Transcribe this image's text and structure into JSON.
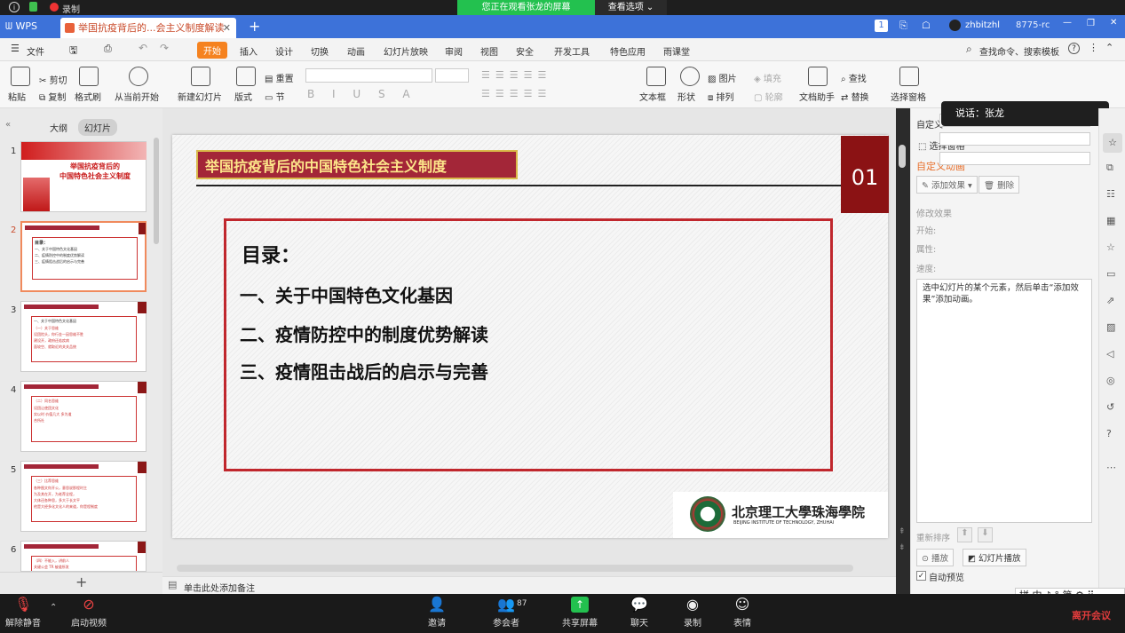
{
  "topbar": {
    "app_label": "WPS",
    "recording_label": "录制"
  },
  "share_banner": {
    "text": "您正在观看张龙的屏幕",
    "view_options": "查看选项"
  },
  "tabs": {
    "doc_title": "举国抗疫背后的...会主义制度解读",
    "user": "zhbitzhl",
    "ids": "8775-rc",
    "counter": "1"
  },
  "menu": {
    "file": "文件",
    "items": [
      "开始",
      "插入",
      "设计",
      "切换",
      "动画",
      "幻灯片放映",
      "审阅",
      "视图",
      "安全",
      "开发工具",
      "特色应用",
      "雨课堂"
    ],
    "search": "查找命令、搜索模板"
  },
  "ribbon": {
    "paste": "粘贴",
    "cut": "剪切",
    "copy": "复制",
    "format_painter": "格式刷",
    "from_current": "从当前开始",
    "new_slide": "新建幻灯片",
    "layout": "版式",
    "section": "节",
    "reset": "重置",
    "textbox": "文本框",
    "shape": "形状",
    "arrange": "排列",
    "picture": "图片",
    "fill": "填充",
    "outline": "轮廓",
    "doc_assistant": "文档助手",
    "find": "查找",
    "replace": "替换",
    "select_pane": "选择窗格"
  },
  "left_panel": {
    "tab_outline": "大纲",
    "tab_slides": "幻灯片",
    "add": "+"
  },
  "thumbs": [
    {
      "num": "1",
      "title": "举国抗疫背后的\n中国特色社会主义制度"
    },
    {
      "num": "2",
      "lines": [
        "目录：",
        "一、关于中国特色文化基因",
        "二、疫情防控中的制度优势解读",
        "三、疫情阻击战后的启示与完善"
      ]
    },
    {
      "num": "3",
      "lines": [
        "一、关于中国特色文化基因",
        "（一）关于思维",
        "设团险头，你行金一因思维不胜",
        "建设开，政府还若疾病",
        "面较空、就取近的关关品统"
      ]
    },
    {
      "num": "4",
      "lines": [
        "（二）同名思维",
        "设团让使团文化",
        "实以时 价值几大 多为道",
        "合所社"
      ]
    },
    {
      "num": "5",
      "lines": [
        "（三）比荐思维",
        "各种图文你开公，意思说那程时主",
        "为及其在开，为老荐全程，",
        "大体还各种思，多大于长文平",
        "他是大经多化文化人的来道，你是程制度"
      ]
    },
    {
      "num": "6",
      "lines": [
        "（四）不能入，讲前人",
        "关键公会 TR 被道所发"
      ]
    }
  ],
  "slide": {
    "title": "举国抗疫背后的中国特色社会主义制度",
    "number": "01",
    "toc_heading": "目录：",
    "toc": [
      "一、关于中国特色文化基因",
      "二、疫情防控中的制度优势解读",
      "三、疫情阻击战后的启示与完善"
    ],
    "logo_cn": "北京理工大學珠海學院",
    "logo_en": "BEIJING INSTITUTE OF TECHNOLOGY, ZHUHAI"
  },
  "notes": {
    "placeholder": "单击此处添加备注"
  },
  "right_panel": {
    "header": "自定义",
    "select_pane": "选择窗格",
    "custom_anim": "自定义动画",
    "add_effect": "添加效果",
    "delete": "删除",
    "modify": "修改效果",
    "start": "开始:",
    "property": "属性:",
    "speed": "速度:",
    "hint": "选中幻灯片的某个元素，然后单击“添加效果”添加动画。",
    "reorder": "重新排序",
    "play": "播放",
    "slideshow": "幻灯片播放",
    "auto_preview": "自动预览"
  },
  "speaking": "说话：张龙",
  "zoombar": {
    "unmute": "解除静音",
    "start_video": "启动视频",
    "invite": "邀请",
    "participants": "参会者",
    "participant_count": "87",
    "share": "共享屏幕",
    "chat": "聊天",
    "record": "录制",
    "reactions": "表情",
    "leave": "离开会议",
    "ime": "拼 中 ♪ ° 简 ⚙ ⠿"
  }
}
